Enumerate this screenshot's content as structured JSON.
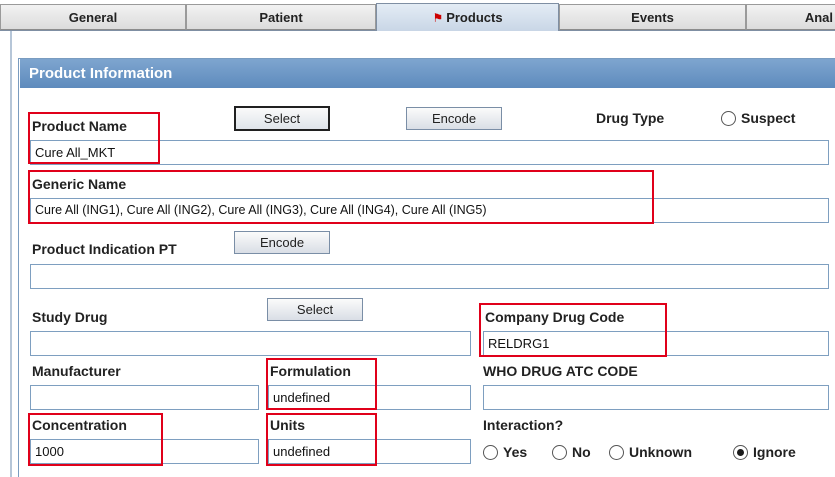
{
  "tabs": [
    {
      "label": "General",
      "active": false
    },
    {
      "label": "Patient",
      "active": false
    },
    {
      "label": "Products",
      "active": true,
      "icon": "flag-icon"
    },
    {
      "label": "Events",
      "active": false
    },
    {
      "label": "Anal",
      "active": false
    }
  ],
  "panel": {
    "title": "Product Information"
  },
  "product_name": {
    "label": "Product Name",
    "value": "Cure All_MKT",
    "select_label": "Select",
    "encode_label": "Encode"
  },
  "drug_type": {
    "label": "Drug Type",
    "option": "Suspect",
    "selected": false
  },
  "generic_name": {
    "label": "Generic Name",
    "value": "Cure All (ING1), Cure All (ING2), Cure All (ING3), Cure All (ING4), Cure All (ING5)"
  },
  "indication": {
    "label": "Product Indication PT",
    "encode_label": "Encode",
    "value": ""
  },
  "study_drug": {
    "label": "Study Drug",
    "select_label": "Select",
    "value": ""
  },
  "company_drug_code": {
    "label": "Company Drug Code",
    "value": "RELDRG1"
  },
  "manufacturer": {
    "label": "Manufacturer",
    "value": ""
  },
  "formulation": {
    "label": "Formulation",
    "value": "undefined"
  },
  "who_atc": {
    "label": "WHO DRUG ATC CODE",
    "value": ""
  },
  "concentration": {
    "label": "Concentration",
    "value": "1000"
  },
  "units": {
    "label": "Units",
    "value": "undefined"
  },
  "interaction": {
    "label": "Interaction?",
    "options": [
      {
        "label": "Yes",
        "checked": false
      },
      {
        "label": "No",
        "checked": false
      },
      {
        "label": "Unknown",
        "checked": false
      },
      {
        "label": "Ignore",
        "checked": true
      }
    ]
  },
  "colors": {
    "highlight": "#e0001a",
    "header": "#6b96c6",
    "field_border": "#7e9fc0"
  }
}
